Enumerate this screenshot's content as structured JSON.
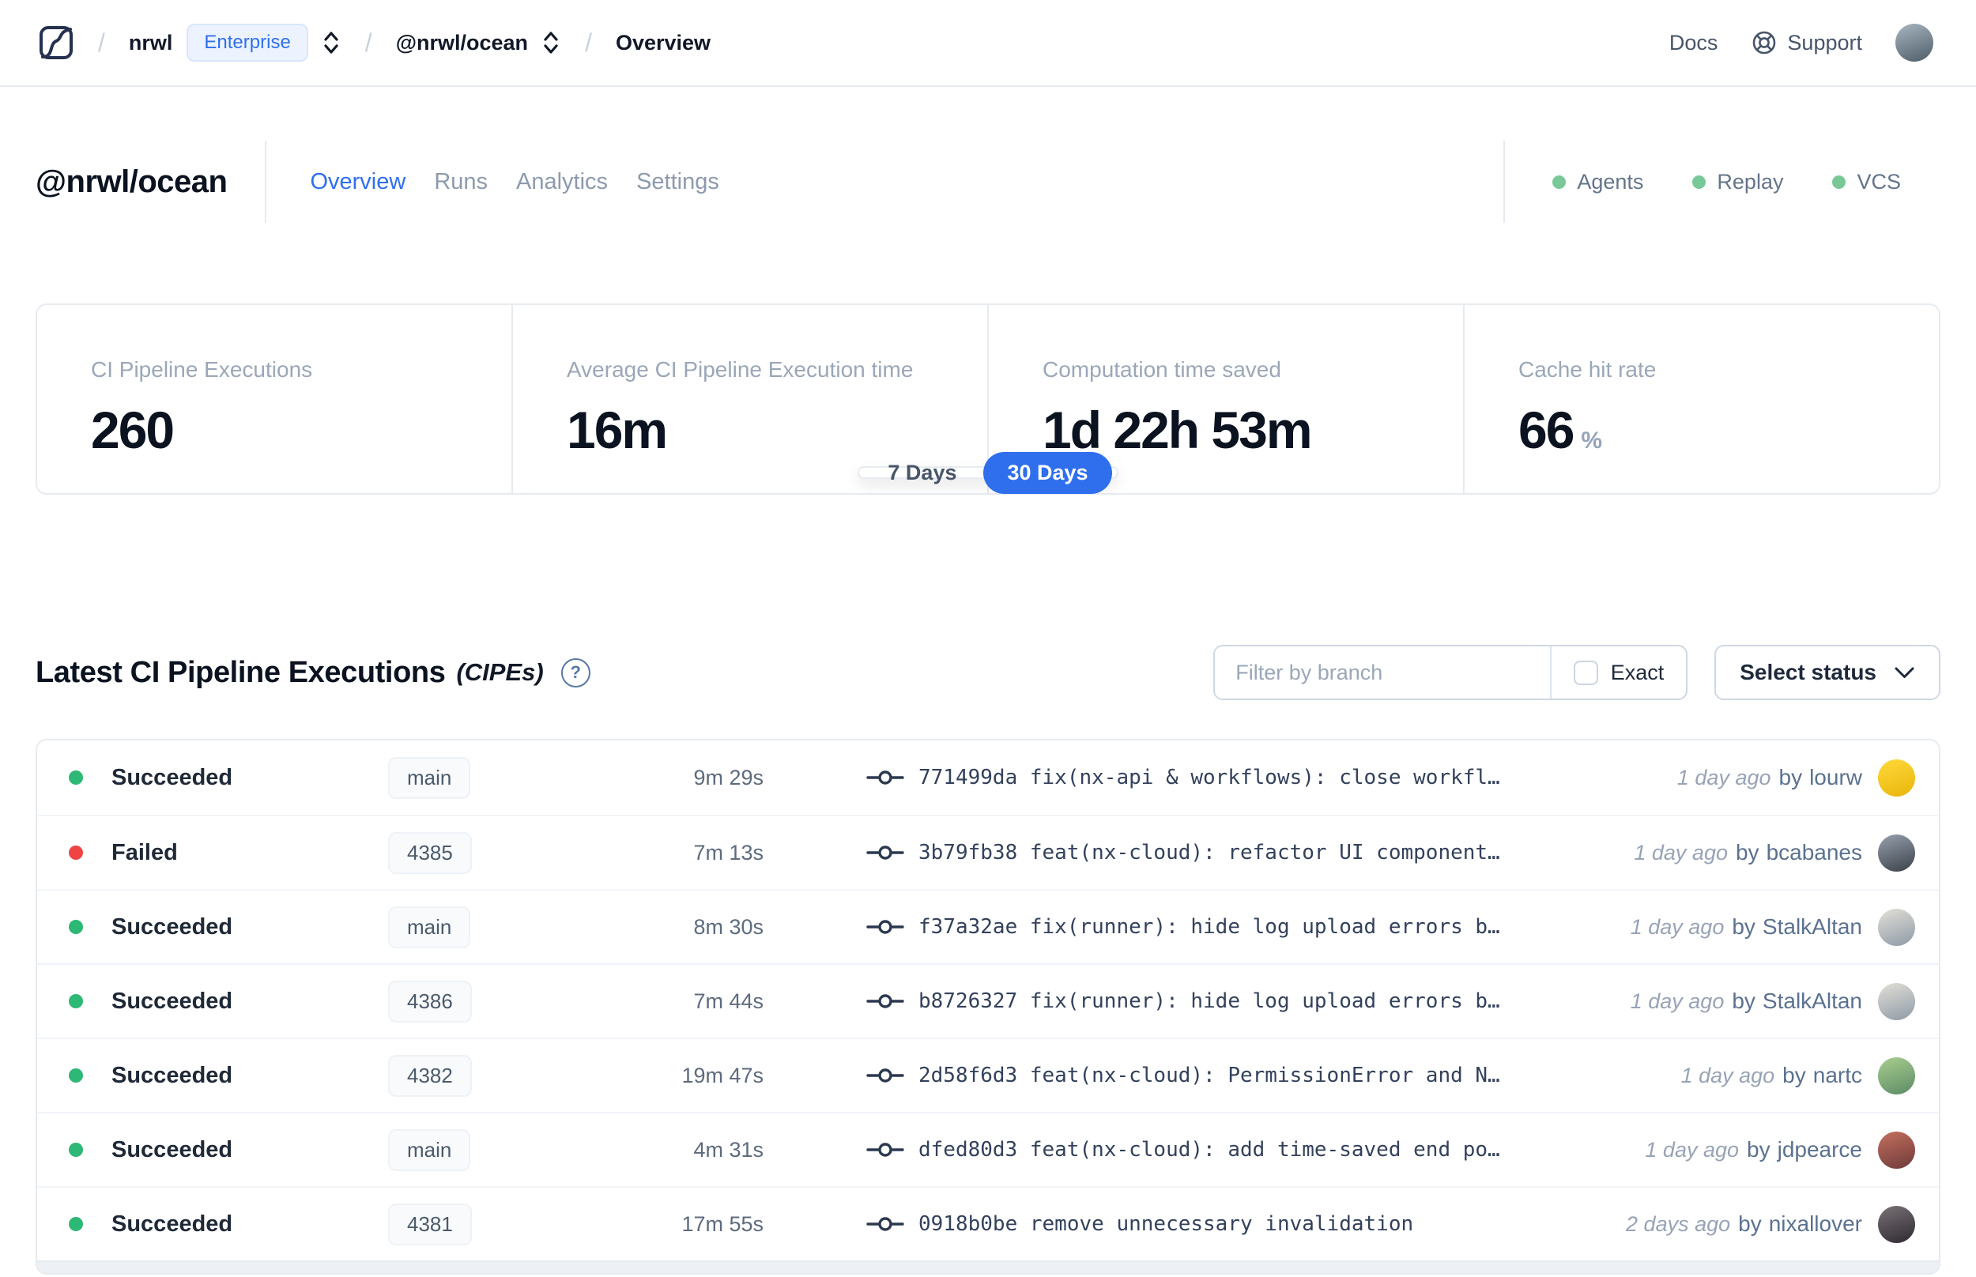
{
  "topbar": {
    "separator": "/",
    "org": "nrwl",
    "org_badge": "Enterprise",
    "workspace": "@nrwl/ocean",
    "page": "Overview",
    "docs_label": "Docs",
    "support_label": "Support",
    "avatar_gradient": "linear-gradient(160deg,#a9b6c2,#4e5d68)"
  },
  "workspace_header": {
    "title": "@nrwl/ocean",
    "tabs": [
      {
        "label": "Overview",
        "active": true
      },
      {
        "label": "Runs",
        "active": false
      },
      {
        "label": "Analytics",
        "active": false
      },
      {
        "label": "Settings",
        "active": false
      }
    ],
    "service_dot_color": "#79c998",
    "services": [
      {
        "label": "Agents"
      },
      {
        "label": "Replay"
      },
      {
        "label": "VCS"
      }
    ]
  },
  "stats": {
    "cards": [
      {
        "label": "CI Pipeline Executions",
        "value": "260",
        "unit": ""
      },
      {
        "label": "Average CI Pipeline Execution time",
        "value": "16m",
        "unit": ""
      },
      {
        "label": "Computation time saved",
        "value": "1d 22h 53m",
        "unit": ""
      },
      {
        "label": "Cache hit rate",
        "value": "66",
        "unit": "%"
      }
    ]
  },
  "range_toggle": {
    "active_color": "#2f6fed",
    "options": [
      {
        "label": "7 Days",
        "active": false
      },
      {
        "label": "30 Days",
        "active": true
      }
    ]
  },
  "section": {
    "title": "Latest CI Pipeline Executions",
    "subtitle": "(CIPEs)",
    "help_glyph": "?"
  },
  "filters": {
    "branch_placeholder": "Filter by branch",
    "exact_label": "Exact",
    "status_button_label": "Select status"
  },
  "table": {
    "by_label": "by",
    "success_color": "#2db875",
    "failed_color": "#ef4444",
    "rows": [
      {
        "status": "Succeeded",
        "status_color": "#2db875",
        "branch": "main",
        "duration": "9m 29s",
        "commit": "771499da fix(nx-api & workflows): close workfl…",
        "time_ago": "1 day ago",
        "author": "lourw",
        "avatar_gradient": "linear-gradient(160deg,#ffd93b,#e9b50b)"
      },
      {
        "status": "Failed",
        "status_color": "#ef4444",
        "branch": "4385",
        "duration": "7m 13s",
        "commit": "3b79fb38 feat(nx-cloud): refactor UI component…",
        "time_ago": "1 day ago",
        "author": "bcabanes",
        "avatar_gradient": "linear-gradient(160deg,#97a1ad,#3a4049)"
      },
      {
        "status": "Succeeded",
        "status_color": "#2db875",
        "branch": "main",
        "duration": "8m 30s",
        "commit": "f37a32ae fix(runner): hide log upload errors b…",
        "time_ago": "1 day ago",
        "author": "StalkAltan",
        "avatar_gradient": "linear-gradient(160deg,#e3e0d8,#8e9aa6)"
      },
      {
        "status": "Succeeded",
        "status_color": "#2db875",
        "branch": "4386",
        "duration": "7m 44s",
        "commit": "b8726327 fix(runner): hide log upload errors b…",
        "time_ago": "1 day ago",
        "author": "StalkAltan",
        "avatar_gradient": "linear-gradient(160deg,#e3e0d8,#8e9aa6)"
      },
      {
        "status": "Succeeded",
        "status_color": "#2db875",
        "branch": "4382",
        "duration": "19m 47s",
        "commit": "2d58f6d3 feat(nx-cloud): PermissionError and N…",
        "time_ago": "1 day ago",
        "author": "nartc",
        "avatar_gradient": "linear-gradient(160deg,#a9cf8f,#5c8a66)"
      },
      {
        "status": "Succeeded",
        "status_color": "#2db875",
        "branch": "main",
        "duration": "4m 31s",
        "commit": "dfed80d3 feat(nx-cloud): add time-saved end po…",
        "time_ago": "1 day ago",
        "author": "jdpearce",
        "avatar_gradient": "linear-gradient(160deg,#c4705f,#6e3a3a)"
      },
      {
        "status": "Succeeded",
        "status_color": "#2db875",
        "branch": "4381",
        "duration": "17m 55s",
        "commit": "0918b0be remove unnecessary invalidation",
        "time_ago": "2 days ago",
        "author": "nixallover",
        "avatar_gradient": "linear-gradient(160deg,#7a7277,#2e2a31)"
      }
    ]
  }
}
